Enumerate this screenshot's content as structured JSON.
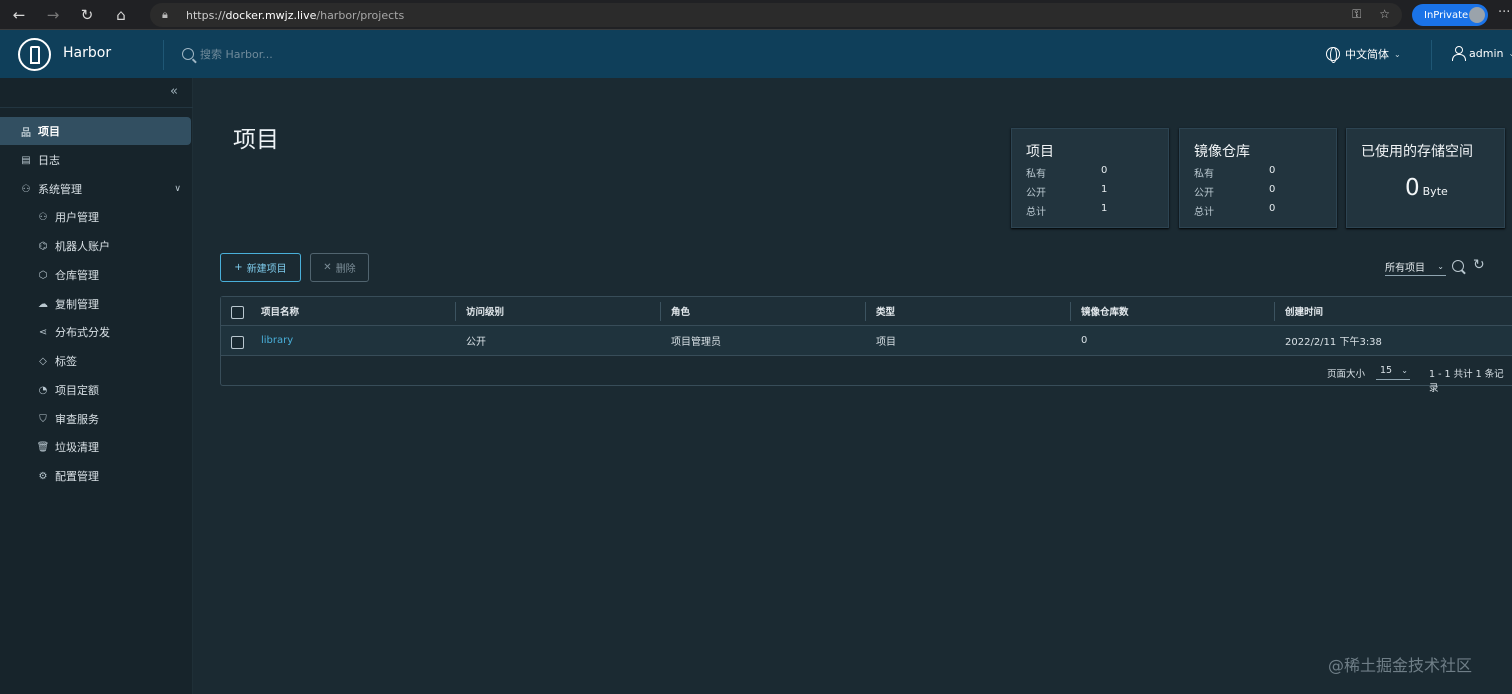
{
  "browser": {
    "url_scheme": "https://",
    "url_host": "docker.mwjz.live",
    "url_path": "/harbor/projects",
    "inprivate_label": "InPrivate"
  },
  "header": {
    "app_name": "Harbor",
    "search_placeholder": "搜索 Harbor...",
    "language": "中文简体",
    "user": "admin"
  },
  "sidebar": {
    "items": [
      {
        "label": "项目",
        "icon": "projects-icon"
      },
      {
        "label": "日志",
        "icon": "logs-icon"
      },
      {
        "label": "系统管理",
        "icon": "admin-icon"
      },
      {
        "label": "用户管理",
        "icon": "users-icon"
      },
      {
        "label": "机器人账户",
        "icon": "robot-icon"
      },
      {
        "label": "仓库管理",
        "icon": "registry-icon"
      },
      {
        "label": "复制管理",
        "icon": "replication-icon"
      },
      {
        "label": "分布式分发",
        "icon": "distribution-icon"
      },
      {
        "label": "标签",
        "icon": "tag-icon"
      },
      {
        "label": "项目定额",
        "icon": "quota-icon"
      },
      {
        "label": "审查服务",
        "icon": "shield-icon"
      },
      {
        "label": "垃圾清理",
        "icon": "trash-icon"
      },
      {
        "label": "配置管理",
        "icon": "gear-icon"
      }
    ]
  },
  "main": {
    "title": "项目",
    "cards": {
      "projects": {
        "title": "项目",
        "private_label": "私有",
        "private": "0",
        "public_label": "公开",
        "public": "1",
        "total_label": "总计",
        "total": "1"
      },
      "repos": {
        "title": "镜像仓库",
        "private_label": "私有",
        "private": "0",
        "public_label": "公开",
        "public": "0",
        "total_label": "总计",
        "total": "0"
      },
      "storage": {
        "title": "已使用的存储空间",
        "value": "0",
        "unit": "Byte"
      }
    },
    "actions": {
      "new_project": "新建项目",
      "delete": "删除"
    },
    "filter": {
      "selected": "所有项目"
    },
    "table": {
      "columns": [
        "项目名称",
        "访问级别",
        "角色",
        "类型",
        "镜像仓库数",
        "创建时间"
      ],
      "rows": [
        {
          "name": "library",
          "access": "公开",
          "role": "项目管理员",
          "type": "项目",
          "repo_count": "0",
          "created": "2022/2/11 下午3:38"
        }
      ],
      "page_size_label": "页面大小",
      "page_size": "15",
      "page_info": "1 - 1 共计 1 条记录"
    }
  },
  "watermark": "@稀土掘金技术社区"
}
